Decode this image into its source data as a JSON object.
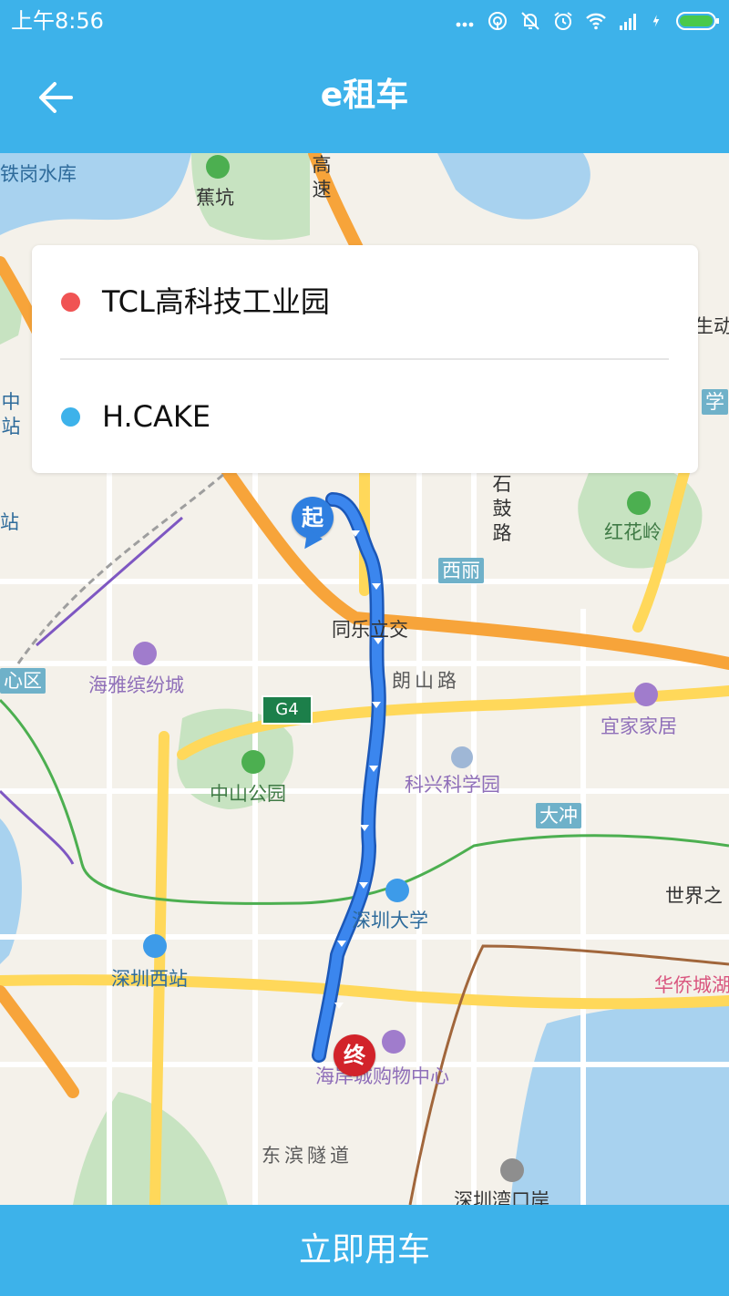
{
  "status_bar": {
    "time": "上午8:56",
    "icons": [
      "more-dots-icon",
      "hotspot-icon",
      "mute-bell-icon",
      "alarm-icon",
      "wifi-icon",
      "signal-icon",
      "charging-icon",
      "battery-icon"
    ]
  },
  "app_bar": {
    "title": "e租车",
    "back_icon": "arrow-left-icon"
  },
  "route": {
    "start": {
      "name": "TCL高科技工业园",
      "dot_color": "#f05454"
    },
    "end": {
      "name": "H.CAKE",
      "dot_color": "#3db2ea"
    }
  },
  "map": {
    "labels": {
      "tiegang_reservoir": "铁岗水库",
      "jiaokeng": "蕉坑",
      "expressway": "高速",
      "shigu_road": "石鼓路",
      "honghualing": "红花岭",
      "xili": "西丽",
      "tongle_interchange": "同乐立交",
      "langshan_road": "朗山路",
      "haiya_mall": "海雅缤纷城",
      "yijia_home": "宜家家居",
      "zhongshan_park": "中山公园",
      "kexing_science_park": "科兴科学园",
      "dachong": "大冲",
      "shenzhen_university": "深圳大学",
      "window_of_world": "世界之",
      "shenzhen_west_station": "深圳西站",
      "overseas_chinese_town": "华侨城湖",
      "coastal_city_mall": "海岸城购物中心",
      "dongbin_tunnel": "东滨隧道",
      "shenzhen_bay_port": "深圳湾口岸",
      "center_district": "心区",
      "edge_zhong_zhan": "中站",
      "edge_zhan": "站",
      "edge_school": "学",
      "edge_dong": "生动",
      "g4": "G4"
    },
    "markers": {
      "start": "起",
      "end": "终"
    },
    "colors": {
      "route": "#2f7fe0",
      "expressway": "#f7a43a",
      "main_road": "#ffd85a",
      "water": "#a8d2ef",
      "green": "#c7e3c1"
    }
  },
  "action": {
    "button_label": "立即用车"
  }
}
